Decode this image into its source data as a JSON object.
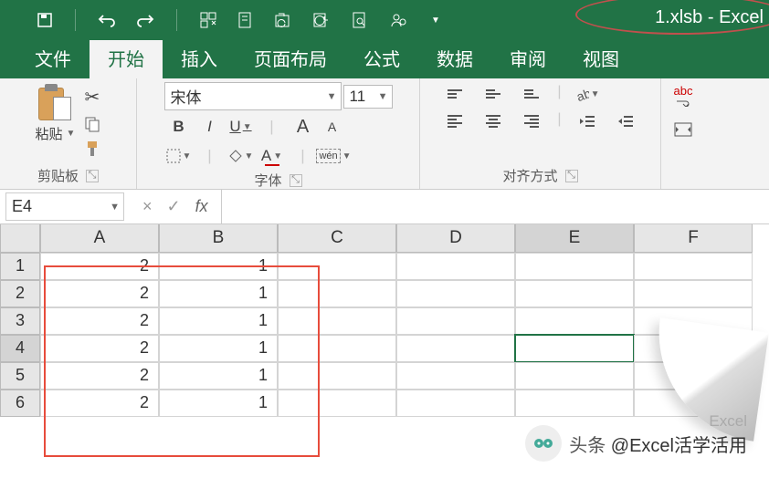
{
  "titlebar": {
    "filename": "1.xlsb",
    "separator": " - ",
    "appname": "Excel"
  },
  "qat_icons": [
    "save-icon",
    "undo-icon",
    "redo-icon",
    "touch-icon",
    "dup-icon",
    "open-dup-icon",
    "refresh-icon",
    "preview-icon",
    "share-icon"
  ],
  "tabs": {
    "file": "文件",
    "home": "开始",
    "insert": "插入",
    "layout": "页面布局",
    "formulas": "公式",
    "data": "数据",
    "review": "审阅",
    "view": "视图"
  },
  "ribbon": {
    "clipboard": {
      "paste": "粘贴",
      "label": "剪贴板"
    },
    "font": {
      "name": "宋体",
      "size": "11",
      "bold": "B",
      "italic": "I",
      "underline": "U",
      "increase": "A",
      "decrease": "A",
      "fontcolor": "A",
      "phonetic": "wén",
      "label": "字体"
    },
    "alignment": {
      "label": "对齐方式"
    },
    "editing": {
      "abc": "abc"
    }
  },
  "namebox": {
    "value": "E4"
  },
  "fxbar": {
    "cancel": "×",
    "enter": "✓",
    "fx": "fx"
  },
  "sheet": {
    "cols": [
      "A",
      "B",
      "C",
      "D",
      "E",
      "F"
    ],
    "rows": [
      "1",
      "2",
      "3",
      "4",
      "5",
      "6"
    ],
    "selected_row": 4,
    "selected_col": "E",
    "data": [
      {
        "A": "2",
        "B": "1"
      },
      {
        "A": "2",
        "B": "1"
      },
      {
        "A": "2",
        "B": "1"
      },
      {
        "A": "2",
        "B": "1"
      },
      {
        "A": "2",
        "B": "1"
      },
      {
        "A": "2",
        "B": "1"
      }
    ]
  },
  "watermark": {
    "line1": "Excel",
    "prefix": "头条",
    "text": "@Excel活学活用"
  }
}
